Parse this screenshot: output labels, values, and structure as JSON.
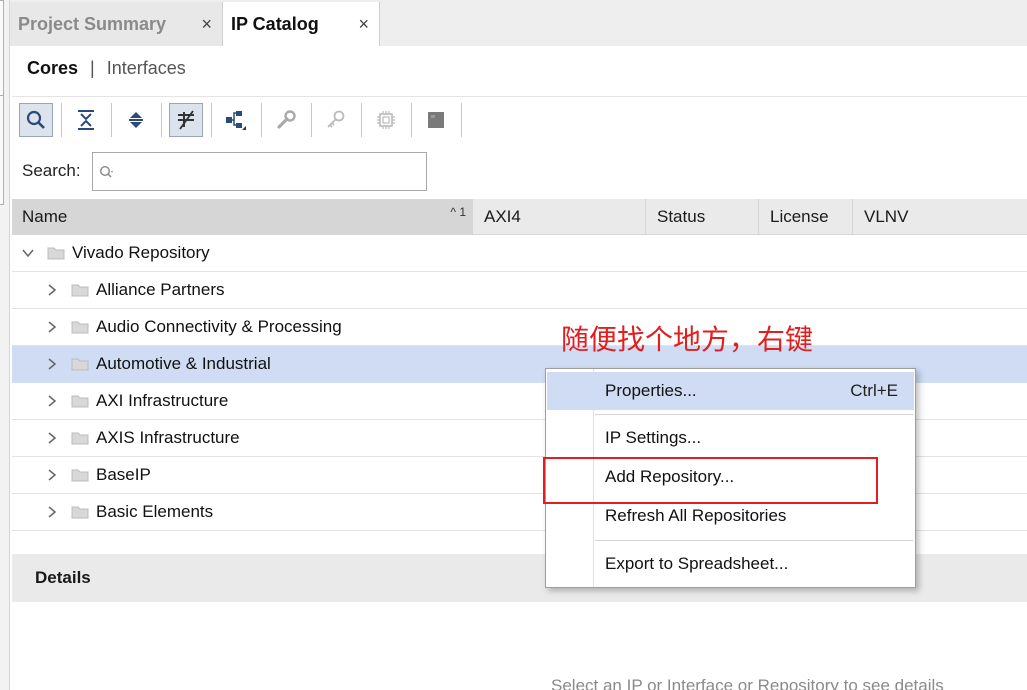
{
  "tabs": [
    {
      "label": "Project Summary",
      "close": "×"
    },
    {
      "label": "IP Catalog",
      "close": "×"
    }
  ],
  "subtabs": {
    "cores": "Cores",
    "sep": "|",
    "interfaces": "Interfaces"
  },
  "toolbar": {
    "buttons": [
      "search-icon",
      "collapse-all-icon",
      "expand-all-icon",
      "filter-icon",
      "hierarchy-icon",
      "wrench-icon",
      "key-icon",
      "chip-icon",
      "block-icon"
    ]
  },
  "search": {
    "label": "Search:",
    "value": "",
    "placeholder": ""
  },
  "table": {
    "columns": [
      "Name",
      "AXI4",
      "Status",
      "License",
      "VLNV"
    ],
    "sort_indicator": "^ 1",
    "rows": [
      {
        "label": "Vivado Repository",
        "expanded": true
      },
      {
        "label": "Alliance Partners"
      },
      {
        "label": "Audio Connectivity & Processing"
      },
      {
        "label": "Automotive & Industrial"
      },
      {
        "label": "AXI Infrastructure"
      },
      {
        "label": "AXIS Infrastructure"
      },
      {
        "label": "BaseIP"
      },
      {
        "label": "Basic Elements"
      }
    ]
  },
  "annotation": "随便找个地方，右键",
  "details": {
    "title": "Details",
    "hint": "Select an IP or Interface or Repository to see details"
  },
  "context_menu": {
    "items": [
      {
        "label": "Properties...",
        "shortcut": "Ctrl+E"
      },
      {
        "label": "IP Settings..."
      },
      {
        "label": "Add Repository..."
      },
      {
        "label": "Refresh All Repositories"
      },
      {
        "label": "Export to Spreadsheet..."
      }
    ]
  },
  "colors": {
    "selection": "#cfdcf4",
    "annotation_red": "#e02020",
    "header_bg": "#eaeaea"
  }
}
